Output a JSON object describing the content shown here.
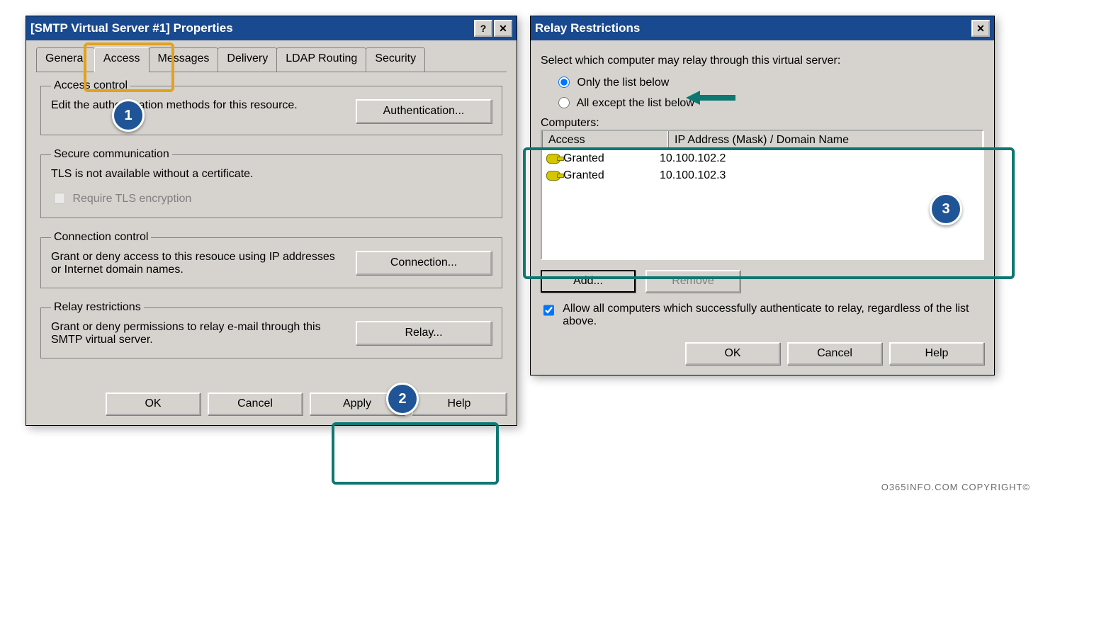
{
  "dialog_properties": {
    "title": "[SMTP Virtual Server #1] Properties",
    "help_btn": "?",
    "close_btn": "✕",
    "tabs": {
      "general": "General",
      "access": "Access",
      "messages": "Messages",
      "delivery": "Delivery",
      "ldap": "LDAP Routing",
      "security": "Security"
    },
    "group_access": {
      "legend": "Access control",
      "text": "Edit the authentication methods for this resource.",
      "button": "Authentication..."
    },
    "group_secure": {
      "legend": "Secure communication",
      "text": "TLS is not available without a certificate.",
      "checkbox": "Require TLS encryption"
    },
    "group_conn": {
      "legend": "Connection control",
      "text": "Grant or deny access to this resouce using IP addresses or Internet domain names.",
      "button": "Connection..."
    },
    "group_relay": {
      "legend": "Relay restrictions",
      "text": "Grant or deny permissions to relay e-mail through this SMTP virtual server.",
      "button": "Relay..."
    },
    "footer": {
      "ok": "OK",
      "cancel": "Cancel",
      "apply": "Apply",
      "help": "Help"
    }
  },
  "dialog_relay": {
    "title": "Relay Restrictions",
    "close_btn": "✕",
    "intro": "Select which computer may relay through this virtual server:",
    "radio_only": "Only the list below",
    "radio_except": "All except the list below",
    "computers_label": "Computers:",
    "col_access": "Access",
    "col_ip": "IP Address (Mask) / Domain Name",
    "rows": [
      {
        "access": "Granted",
        "ip": "10.100.102.2"
      },
      {
        "access": "Granted",
        "ip": "10.100.102.3"
      }
    ],
    "add_btn": "Add...",
    "remove_btn": "Remove",
    "allow_checkbox": "Allow all computers which successfully authenticate to relay, regardless of the list above.",
    "footer": {
      "ok": "OK",
      "cancel": "Cancel",
      "help": "Help"
    }
  },
  "annotations": {
    "badge1": "1",
    "badge2": "2",
    "badge3": "3"
  },
  "copyright": "O365INFO.COM COPYRIGHT©"
}
